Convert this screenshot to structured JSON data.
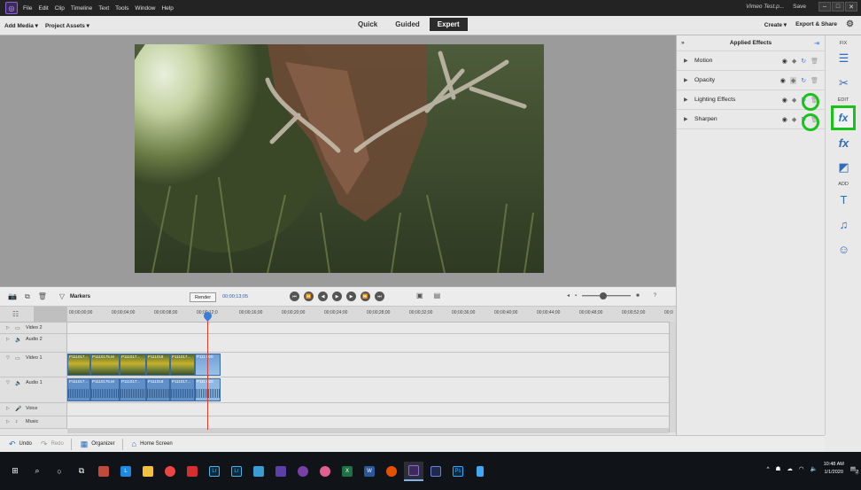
{
  "menubar": {
    "items": [
      "File",
      "Edit",
      "Clip",
      "Timeline",
      "Text",
      "Tools",
      "Window",
      "Help"
    ],
    "doc_title": "Vimeo Test.p...",
    "save": "Save",
    "window_buttons": [
      "–",
      "□",
      "✕"
    ]
  },
  "modebar": {
    "add_media": "Add Media ▾",
    "project_assets": "Project Assets ▾",
    "modes": [
      "Quick",
      "Guided",
      "Expert"
    ],
    "active_mode": "Expert",
    "create": "Create ▾",
    "export_share": "Export & Share"
  },
  "effects_panel": {
    "title": "Applied Effects",
    "effects": [
      {
        "label": "Motion"
      },
      {
        "label": "Opacity"
      },
      {
        "label": "Lighting Effects"
      },
      {
        "label": "Sharpen"
      }
    ]
  },
  "tool_strip": {
    "fix_label": "FIX",
    "edit_label": "EDIT",
    "add_label": "ADD",
    "icons": [
      "adjust-icon",
      "tools-icon",
      "applied-effects-icon",
      "effects-icon",
      "transitions-icon",
      "titles-icon",
      "music-icon",
      "graphics-icon"
    ]
  },
  "timeline": {
    "markers": "Markers",
    "render": "Render",
    "timecode": "00;00;13;05",
    "ruler_ticks": [
      "00;00;00;00",
      "00;00;04;00",
      "00;00;08;00",
      "00;00;12;0",
      "00;00;16;00",
      "00;00;20;00",
      "00;00;24;00",
      "00;00;28;00",
      "00;00;32;00",
      "00;00;36;00",
      "00;00;40;00",
      "00;00;44;00",
      "00;00;48;00",
      "00;00;52;00",
      "00;0"
    ],
    "tracks": [
      {
        "name": "Video 2"
      },
      {
        "name": "Audio 2"
      },
      {
        "name": "Video 1"
      },
      {
        "name": "Audio 1"
      },
      {
        "name": "Voice"
      },
      {
        "name": "Music"
      }
    ],
    "video_clips": [
      "P111017...",
      "P1110175.M",
      "P111017...",
      "P111018",
      "P111017...",
      "P111 029"
    ],
    "audio_clips": [
      "P111017...",
      "P1110175.M",
      "P111017...",
      "P111018",
      "P111017...",
      "P111 029"
    ]
  },
  "bottombar": {
    "undo": "Undo",
    "redo": "Redo",
    "organizer": "Organizer",
    "home_screen": "Home Screen"
  },
  "taskbar": {
    "time": "10:48 AM",
    "date": "1/1/2020",
    "notif_count": "2"
  }
}
